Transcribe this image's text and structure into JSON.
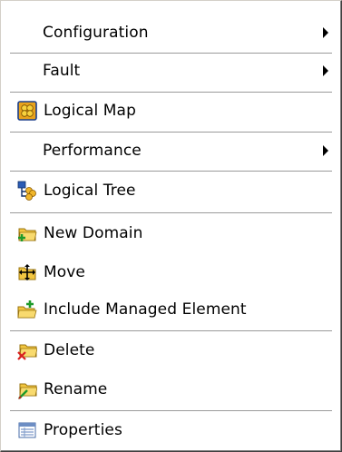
{
  "menu": {
    "items": [
      {
        "label": "Configuration",
        "icon": "submenu-arrow"
      },
      {
        "label": "Fault",
        "icon": "submenu-arrow"
      },
      {
        "label": "Logical Map",
        "icon": "logical-map-icon"
      },
      {
        "label": "Performance",
        "icon": "submenu-arrow"
      },
      {
        "label": "Logical Tree",
        "icon": "logical-tree-icon"
      },
      {
        "label": "New Domain",
        "icon": "new-folder-icon"
      },
      {
        "label": "Move",
        "icon": "move-icon"
      },
      {
        "label": "Include Managed Element",
        "icon": "include-folder-icon"
      },
      {
        "label": "Delete",
        "icon": "delete-folder-icon"
      },
      {
        "label": "Rename",
        "icon": "rename-folder-icon"
      },
      {
        "label": "Properties",
        "icon": "properties-icon"
      }
    ]
  },
  "colors": {
    "folder": "#f2c640",
    "separator": "#9a9a9a",
    "arrow": "#000000"
  }
}
